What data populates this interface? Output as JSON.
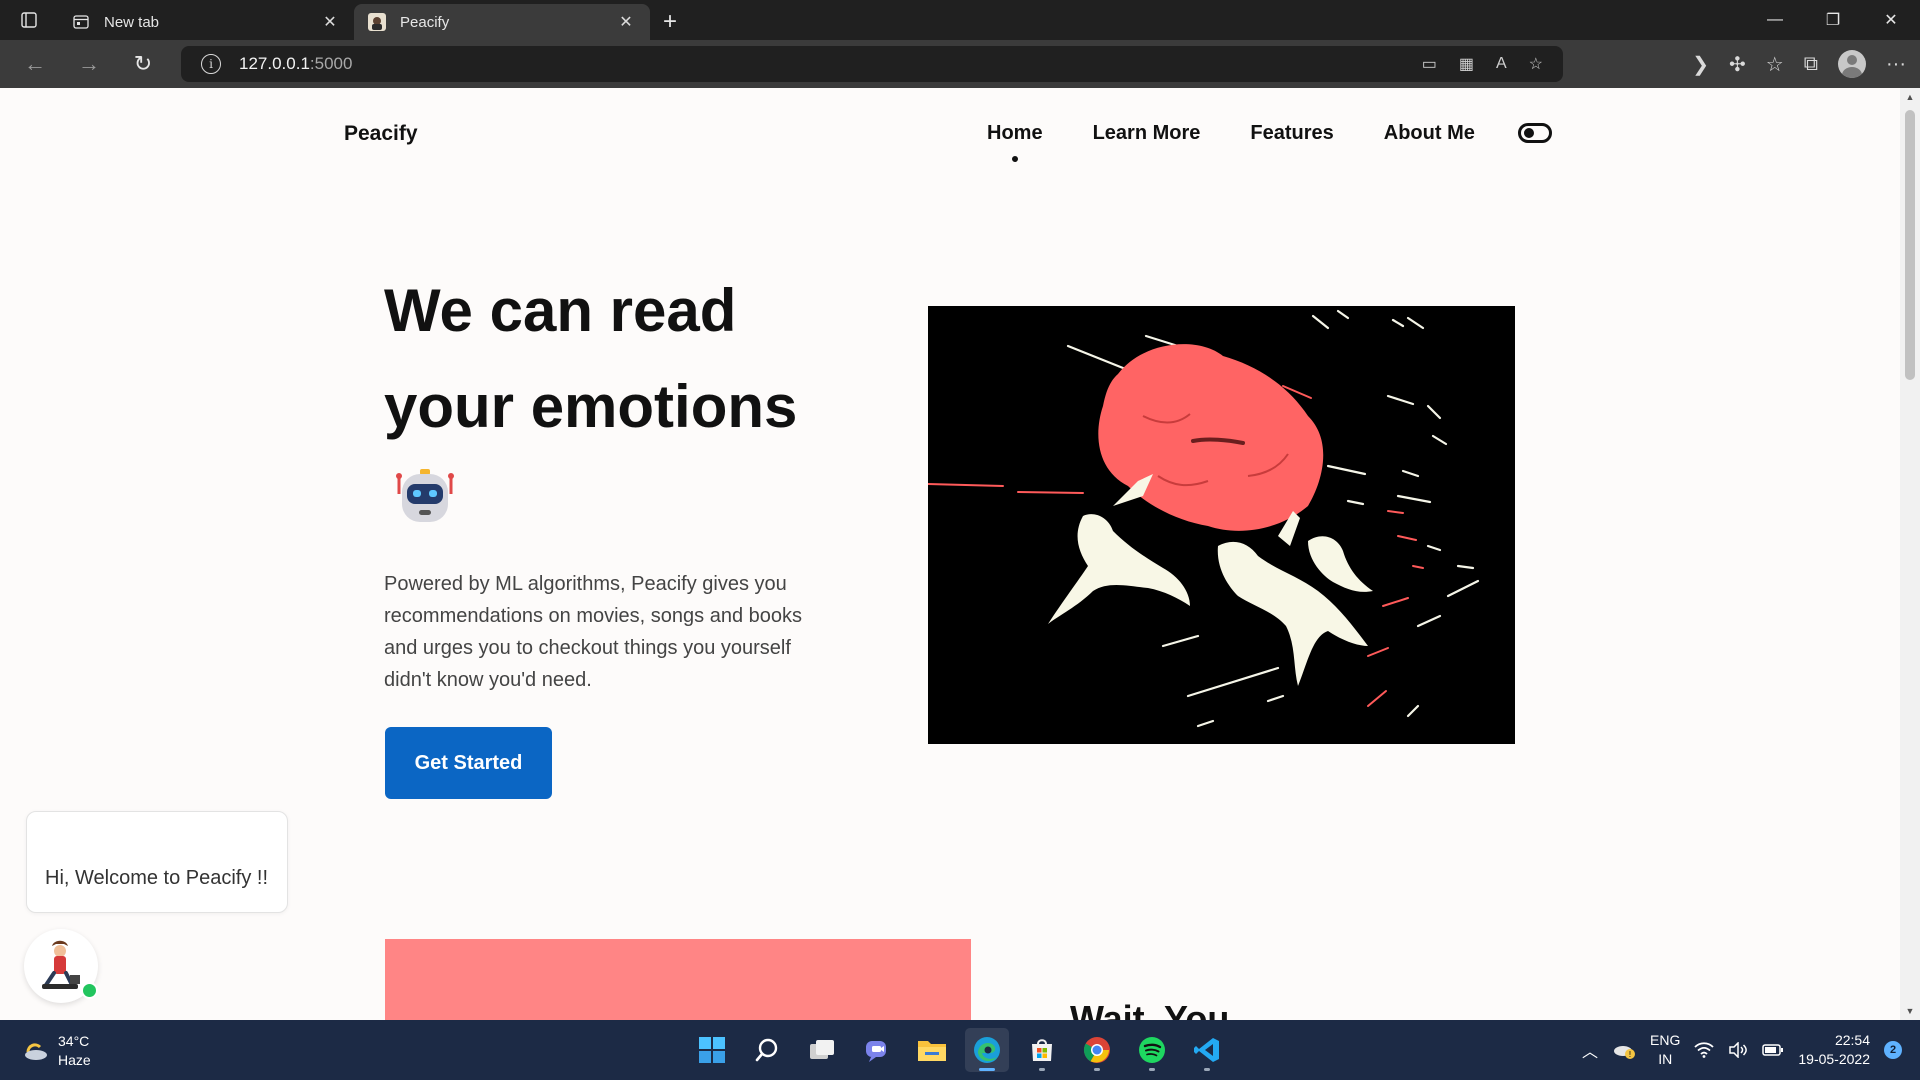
{
  "browser": {
    "tabs": [
      {
        "title": "New tab",
        "active": false
      },
      {
        "title": "Peacify",
        "active": true
      }
    ],
    "url_host": "127.0.0.1",
    "url_port": ":5000"
  },
  "site": {
    "brand": "Peacify",
    "nav": [
      "Home",
      "Learn More",
      "Features",
      "About Me"
    ],
    "hero_title": "We can read your emotions",
    "hero_description": "Powered by ML algorithms, Peacify gives you recommendations on movies, songs and books and urges you to checkout things you yourself didn't know you'd need.",
    "cta_label": "Get Started",
    "partial_heading": "Wait, You",
    "chat_message": "Hi, Welcome to Peacify !!"
  },
  "taskbar": {
    "temperature": "34°C",
    "weather": "Haze",
    "lang_line1": "ENG",
    "lang_line2": "IN",
    "time": "22:54",
    "date": "19-05-2022",
    "notification_count": "2"
  },
  "colors": {
    "accent": "#0b66c4",
    "pink": "#ff8585",
    "brain": "#ff6b6b",
    "taskbar": "#1c2a45"
  }
}
